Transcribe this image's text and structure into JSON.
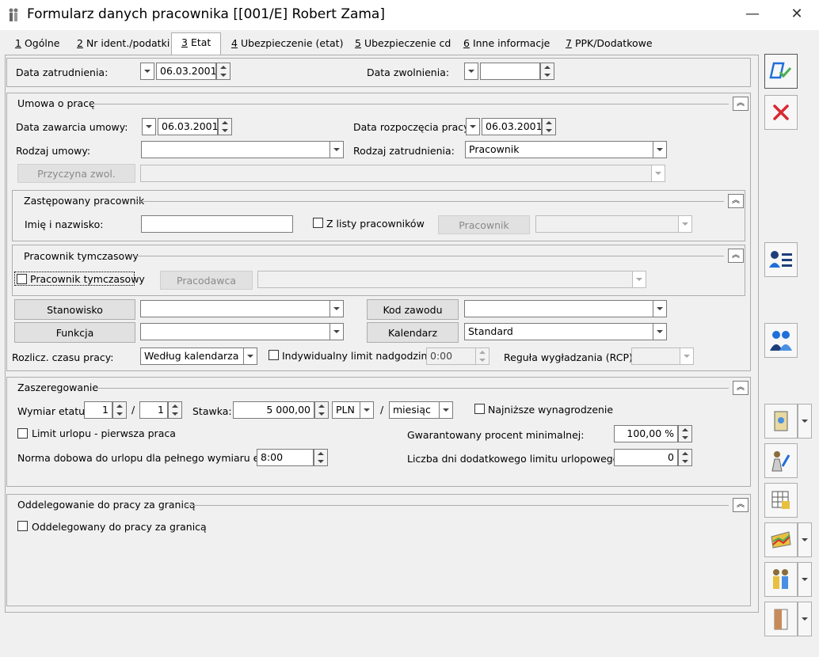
{
  "window": {
    "title": "Formularz danych pracownika [[001/E] Robert Zama]"
  },
  "tabs": [
    {
      "num": "1",
      "label": "Ogólne"
    },
    {
      "num": "2",
      "label": "Nr ident./podatki"
    },
    {
      "num": "3",
      "label": "Etat"
    },
    {
      "num": "4",
      "label": "Ubezpieczenie (etat)"
    },
    {
      "num": "5",
      "label": "Ubezpieczenie cd"
    },
    {
      "num": "6",
      "label": "Inne informacje"
    },
    {
      "num": "7",
      "label": "PPK/Dodatkowe"
    }
  ],
  "top": {
    "hire_date_label": "Data zatrudnienia:",
    "hire_date": "06.03.2001",
    "fire_date_label": "Data zwolnienia:",
    "fire_date": ""
  },
  "umowa": {
    "title": "Umowa o pracę",
    "contract_date_label": "Data zawarcia umowy:",
    "contract_date": "06.03.2001",
    "start_date_label": "Data rozpoczęcia pracy:",
    "start_date": "06.03.2001",
    "contract_type_label": "Rodzaj umowy:",
    "contract_type": "",
    "employment_type_label": "Rodzaj zatrudnienia:",
    "employment_type": "Pracownik",
    "reason_button": "Przyczyna zwol.",
    "reason": ""
  },
  "zastepowany": {
    "title": "Zastępowany pracownik",
    "name_label": "Imię i nazwisko:",
    "name": "",
    "from_list_label": "Z listy pracowników",
    "employee_button": "Pracownik",
    "employee": ""
  },
  "tymczasowy": {
    "title": "Pracownik tymczasowy",
    "checkbox_label": "Pracownik tymczasowy",
    "employer_button": "Pracodawca",
    "employer": ""
  },
  "stanowisko": {
    "position_button": "Stanowisko",
    "position": "",
    "job_code_button": "Kod zawodu",
    "job_code": "",
    "function_button": "Funkcja",
    "function": "",
    "calendar_button": "Kalendarz",
    "calendar": "Standard",
    "worktime_label": "Rozlicz. czasu pracy:",
    "worktime": "Według kalendarza",
    "overtime_label": "Indywidualny limit nadgodzin:",
    "overtime": "0:00",
    "rcp_label": "Reguła wygładzania (RCP):",
    "rcp": ""
  },
  "zaszeregowanie": {
    "title": "Zaszeregowanie",
    "fte_label": "Wymiar etatu:",
    "fte_num": "1",
    "fte_sep": "/",
    "fte_den": "1",
    "rate_label": "Stawka:",
    "rate": "5 000,00",
    "currency": "PLN",
    "period_sep": "/",
    "period": "miesiąc",
    "min_wage_label": "Najniższe wynagrodzenie",
    "leave_limit_label": "Limit urlopu - pierwsza praca",
    "guaranteed_label": "Gwarantowany procent minimalnej:",
    "guaranteed": "100,00 %",
    "daily_norm_label": "Norma dobowa do urlopu dla pełnego wymiaru etatu",
    "daily_norm": "8:00",
    "extra_days_label": "Liczba dni dodatkowego limitu urlopowego:",
    "extra_days": "0"
  },
  "oddelegowanie": {
    "title": "Oddelegowanie do pracy za granicą",
    "checkbox_label": "Oddelegowany do pracy za granicą"
  },
  "colors": {
    "accent": "#1e6fd9",
    "cancel": "#d9282f"
  }
}
